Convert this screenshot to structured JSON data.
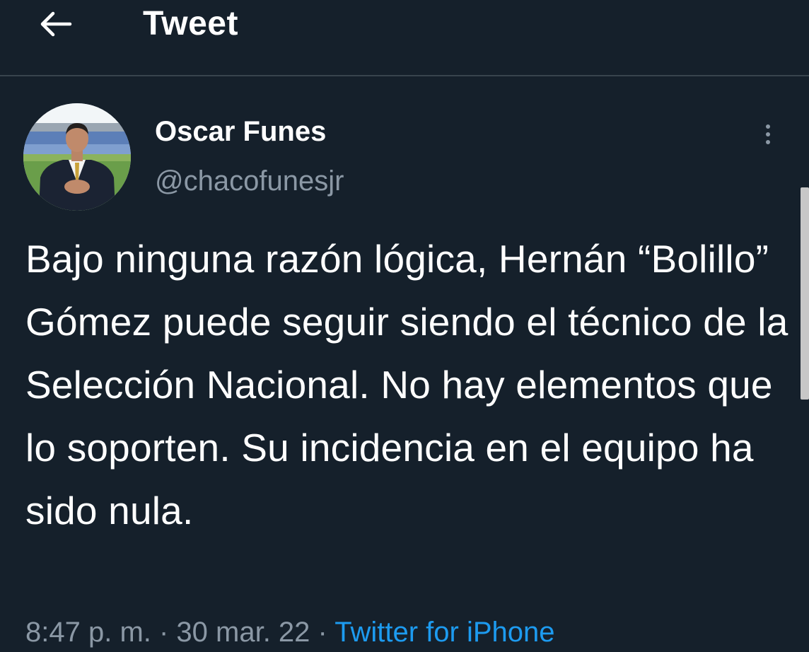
{
  "header": {
    "title": "Tweet",
    "back_icon": "arrow-left-icon"
  },
  "tweet": {
    "author": {
      "name": "Oscar Funes",
      "handle": "@chacofunesjr"
    },
    "more_icon": "more-vertical-icon",
    "text": "Bajo ninguna razón lógica, Hernán “Bolillo” Gómez puede seguir siendo el técnico de la Selección Nacional. No hay elementos que lo soporten. Su incidencia en el equipo ha sido nula.",
    "time": "8:47 p. m.",
    "separator": " · ",
    "date": "30 mar. 22",
    "source": "Twitter for iPhone"
  },
  "colors": {
    "background": "#15202b",
    "secondary_text": "#8b98a5",
    "link": "#1d9bf0",
    "divider": "#38444d"
  }
}
